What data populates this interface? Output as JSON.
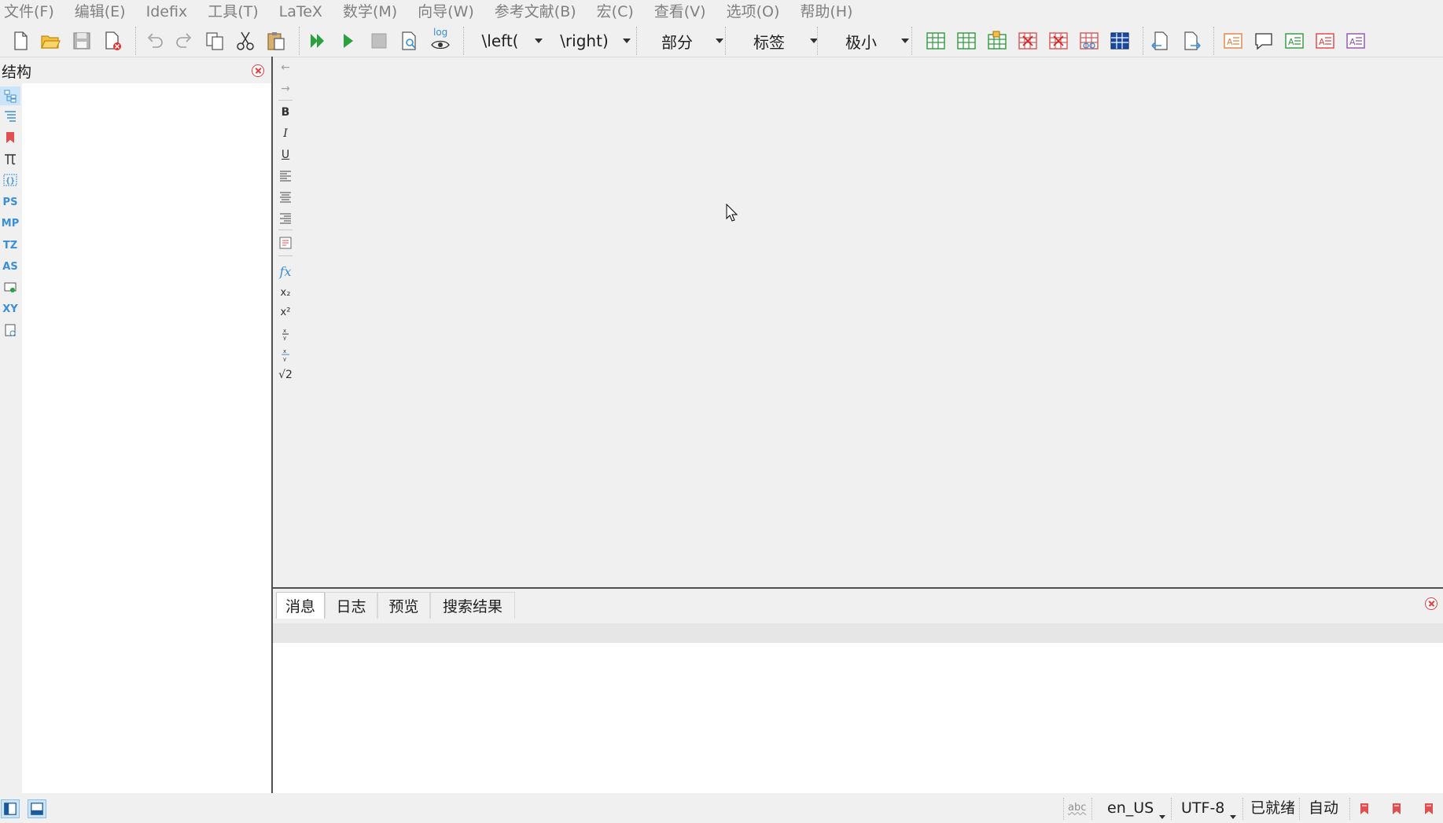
{
  "menu": [
    "文件(F)",
    "编辑(E)",
    "Idefix",
    "工具(T)",
    "LaTeX",
    "数学(M)",
    "向导(W)",
    "参考文献(B)",
    "宏(C)",
    "查看(V)",
    "选项(O)",
    "帮助(H)"
  ],
  "toolbar": {
    "combo_left": "\\left(",
    "combo_right": "\\right)",
    "combo_section": "部分",
    "combo_label": "标签",
    "combo_size": "极小",
    "log_text": "log"
  },
  "structure": {
    "title": "结构"
  },
  "side_strip": [
    "PS",
    "MP",
    "TZ",
    "AS",
    "XY"
  ],
  "vtool": {
    "back": "←",
    "forward": "→",
    "bold": "B",
    "italic": "I",
    "underline": "U",
    "fx": "fx",
    "sub": "x₂",
    "sup": "x²",
    "sqrt": "√2"
  },
  "tabs": [
    "消息",
    "日志",
    "预览",
    "搜索结果"
  ],
  "status": {
    "spell": "abc",
    "language": "en_US",
    "encoding": "UTF-8",
    "state": "已就绪",
    "mode": "自动"
  },
  "colors": {
    "accent_blue": "#3a8fd6",
    "close_red": "#e04040",
    "run_green": "#2aa040",
    "bookmark_red": "#e05050"
  }
}
